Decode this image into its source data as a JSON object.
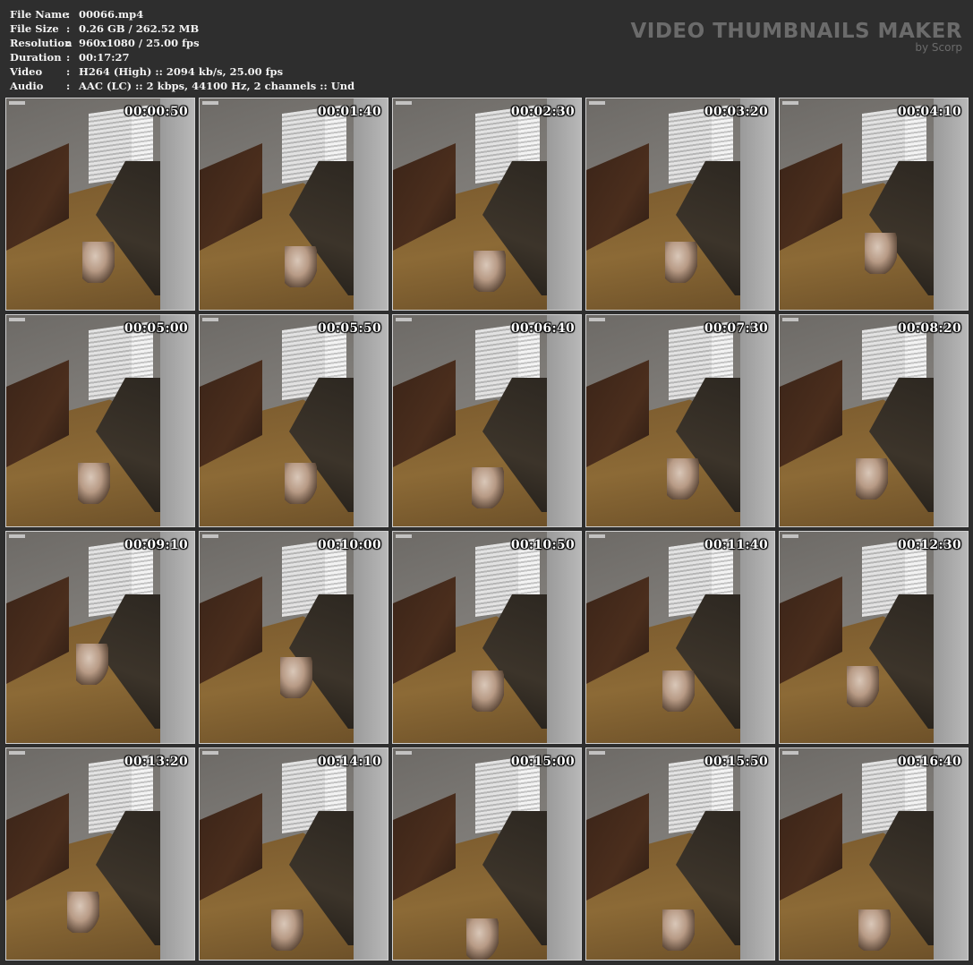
{
  "info": {
    "rows": [
      {
        "key": "File Name",
        "value": "00066.mp4"
      },
      {
        "key": "File Size",
        "value": "0.26 GB  / 262.52 MB"
      },
      {
        "key": "Resolution",
        "value": "960x1080 / 25.00 fps"
      },
      {
        "key": "Duration",
        "value": "00:17:27"
      },
      {
        "key": "Video",
        "value": "H264 (High) :: 2094 kb/s, 25.00 fps"
      },
      {
        "key": "Audio",
        "value": "AAC (LC) :: 2 kbps, 44100 Hz, 2 channels :: Und"
      }
    ],
    "separator": ":"
  },
  "brand": {
    "title": "VIDEO THUMBNAILS MAKER",
    "subtitle": "by Scorp"
  },
  "thumbnails": [
    {
      "time": "00:00:50"
    },
    {
      "time": "00:01:40"
    },
    {
      "time": "00:02:30"
    },
    {
      "time": "00:03:20"
    },
    {
      "time": "00:04:10"
    },
    {
      "time": "00:05:00"
    },
    {
      "time": "00:05:50"
    },
    {
      "time": "00:06:40"
    },
    {
      "time": "00:07:30"
    },
    {
      "time": "00:08:20"
    },
    {
      "time": "00:09:10"
    },
    {
      "time": "00:10:00"
    },
    {
      "time": "00:10:50"
    },
    {
      "time": "00:11:40"
    },
    {
      "time": "00:12:30"
    },
    {
      "time": "00:13:20"
    },
    {
      "time": "00:14:10"
    },
    {
      "time": "00:15:00"
    },
    {
      "time": "00:15:50"
    },
    {
      "time": "00:16:40"
    }
  ],
  "colors": {
    "background": "#2e2e2e",
    "info_text": "#f2f2f2",
    "brand_text": "#6b6b6b",
    "thumb_border": "#d0d0d0"
  }
}
